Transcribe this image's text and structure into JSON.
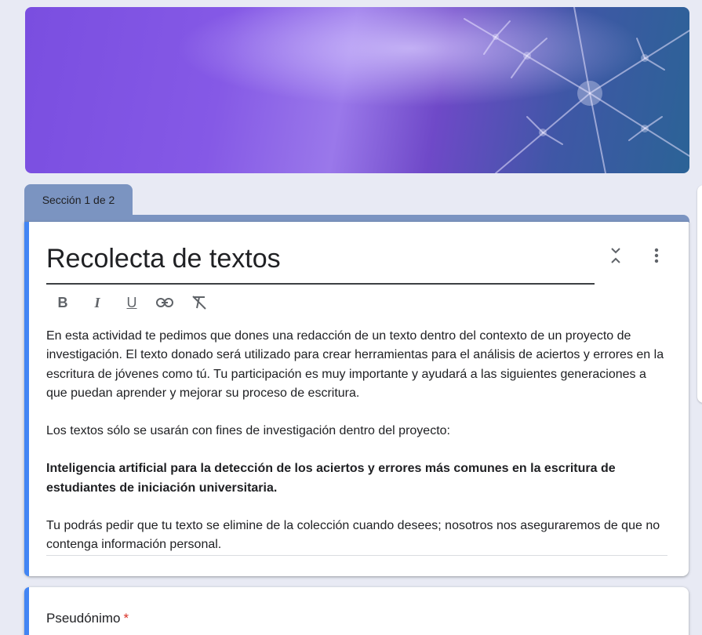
{
  "section_tab": {
    "label": "Sección 1 de 2"
  },
  "section_card": {
    "title": "Recolecta de textos",
    "description": {
      "paragraph_1": "En esta actividad te pedimos que dones una redacción de un texto dentro del contexto de un proyecto de investigación. El texto donado será utilizado para crear herramientas para el análisis de aciertos y errores en la escritura de jóvenes como tú. Tu participación es muy importante y ayudará a las siguientes generaciones a que puedan aprender y mejorar su proceso de escritura.",
      "paragraph_2": "Los textos sólo se usarán con fines de investigación dentro del proyecto:",
      "paragraph_3_bold": "Inteligencia artificial para la detección de los aciertos y errores más comunes en la escritura de estudiantes de iniciación universitaria.",
      "paragraph_4": "Tu podrás pedir que tu texto se elimine de la colección cuando desees; nosotros nos aseguraremos de que no contenga información personal."
    },
    "toolbar": {
      "bold_label": "B",
      "italic_label": "I",
      "underline_label": "U",
      "link_icon": "link-icon",
      "clear_format_icon": "clear-format-icon"
    },
    "icons": {
      "collapse": "unfold-less-icon",
      "more": "more-vert-icon"
    }
  },
  "question": {
    "title": "Pseudónimo",
    "required_mark": "*"
  },
  "colors": {
    "page_bg": "#e8eaf4",
    "section_tab": "#7b94c1",
    "accent_bar": "#4285f4",
    "required": "#d93025"
  }
}
